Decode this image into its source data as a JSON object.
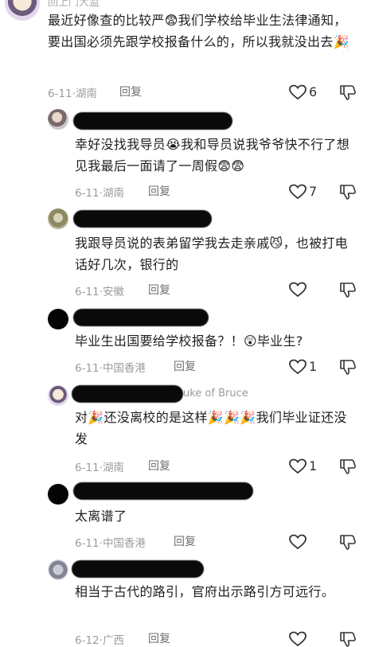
{
  "top_clip": "回上门大监",
  "icons": {
    "like": "heart-outline-icon",
    "dislike": "thumbs-down-outline-icon",
    "emoji_fear": "fearful-face-emoji",
    "emoji_cry": "crying-face-emoji",
    "emoji_party": "party-popper-emoji",
    "emoji_cat": "cat-face-emoji",
    "emoji_shock": "astonished-face-emoji"
  },
  "comments": [
    {
      "text": "最近好像查的比较严😨我们学校给毕业生法律通知，要出国必须先跟学校报备什么的，所以我就没出去🎉",
      "date": "6-11",
      "location": "湖南",
      "reply": "回复",
      "likes": "6"
    },
    {
      "text": "幸好没找我导员😭我和导员说我爷爷快不行了想见我最后一面请了一周假😨😨",
      "date": "6-11",
      "location": "湖南",
      "reply": "回复",
      "likes": "7"
    },
    {
      "text": "我跟导员说的表弟留学我去走亲戚😼，也被打电话好几次，银行的",
      "date": "6-11",
      "location": "安徽",
      "reply": "回复",
      "likes": ""
    },
    {
      "text": "毕业生出国要给学校报备？！😲毕业生?",
      "date": "6-11",
      "location": "中国香港",
      "reply": "回复",
      "likes": "1"
    },
    {
      "username_tail": "uke of Bruce",
      "text": "对🎉还没离校的是这样🎉🎉🎉我们毕业证还没发",
      "date": "6-11",
      "location": "湖南",
      "reply": "回复",
      "likes": "1"
    },
    {
      "text": "太离谱了",
      "date": "6-11",
      "location": "中国香港",
      "reply": "回复",
      "likes": ""
    },
    {
      "text": "相当于古代的路引，官府出示路引方可远行。",
      "date": "6-12",
      "location": "广西",
      "reply": "回复",
      "likes": ""
    }
  ]
}
